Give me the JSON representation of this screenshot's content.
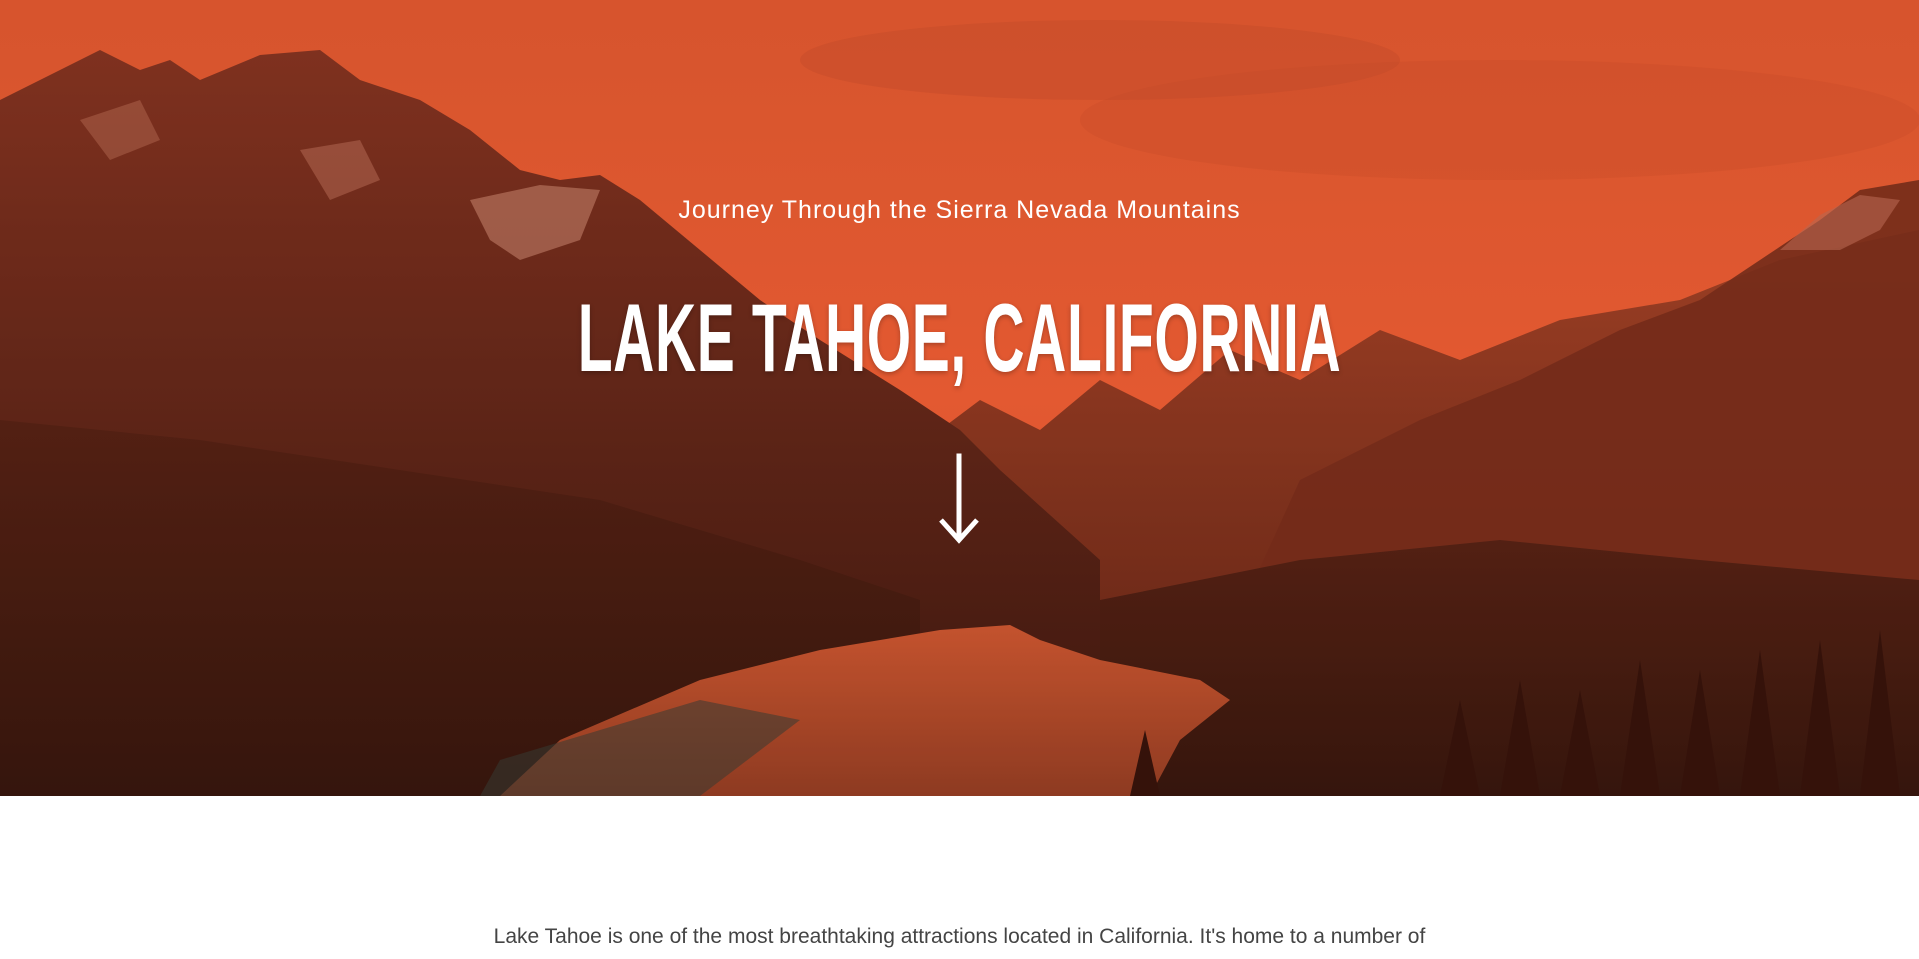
{
  "hero": {
    "subtitle": "Journey Through the Sierra Nevada Mountains",
    "title": "LAKE TAHOE, CALIFORNIA",
    "scroll_icon": "arrow-down-icon",
    "tint_color": "#e25a31"
  },
  "intro": {
    "text": "Lake Tahoe is one of the most breathtaking attractions located in California. It's home to a number of"
  }
}
